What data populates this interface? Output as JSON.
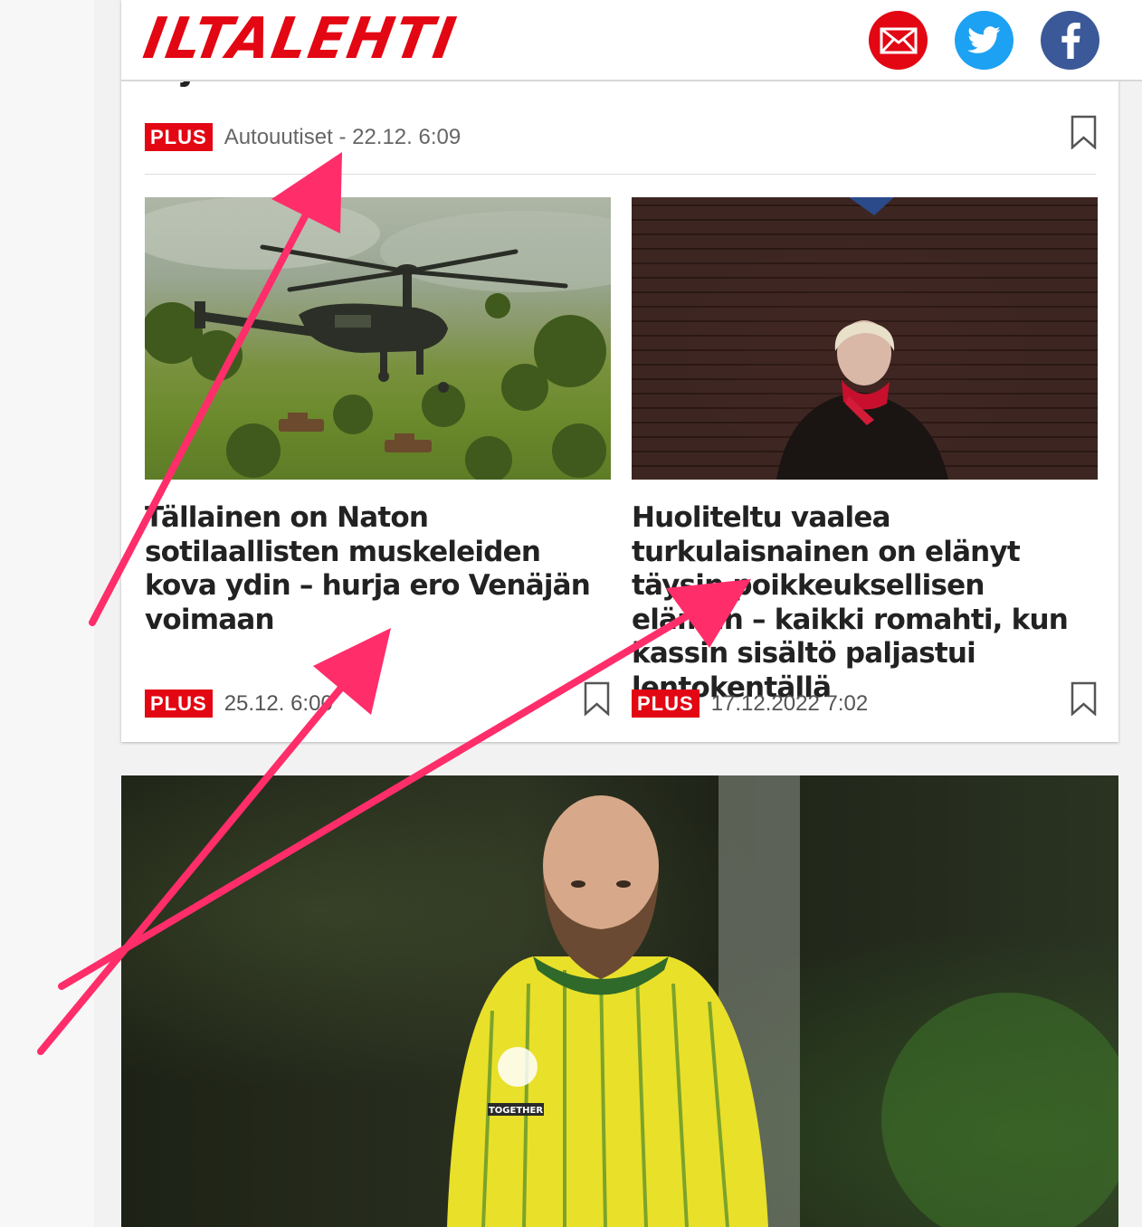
{
  "site": {
    "logo_text": "ILTALEHTI",
    "brand_color": "#e30613"
  },
  "share": {
    "email_icon": "email-icon",
    "twitter_icon": "twitter-icon",
    "facebook_icon": "facebook-icon",
    "colors": {
      "email": "#e30613",
      "twitter": "#1da1f2",
      "facebook": "#3b5998"
    }
  },
  "previous_article": {
    "title_fragment": "sijoittuu",
    "badge": "PLUS",
    "meta": "Autouutiset - 22.12. 6:09"
  },
  "articles": [
    {
      "headline": "Tällainen on Naton sotilaallisten muskeleiden kova ydin – hurja ero Venäjän voimaan",
      "badge": "PLUS",
      "date": "25.12. 6:00",
      "image": "helicopter-over-tanks-photo"
    },
    {
      "headline": "Huoliteltu vaalea turkulaisnainen on elänyt täysin poikkeuksellisen elämän – kaikki romahti, kun kassin sisältö paljastui lentokentällä",
      "badge": "PLUS",
      "date": "17.12.2022 7:02",
      "image": "woman-against-brick-wall-photo"
    }
  ],
  "hero": {
    "image": "bearded-footballer-yellow-shirt-photo",
    "shirt_text": "TOGETHER"
  },
  "annotation": {
    "arrow_color": "#ff2d6a"
  }
}
